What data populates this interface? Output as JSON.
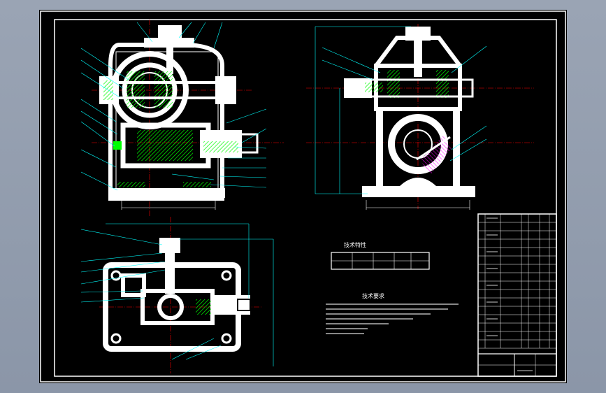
{
  "drawing": {
    "tech_spec_title": "技术特性",
    "tech_req_title": "技术要求",
    "colors": {
      "background": "#000000",
      "frame": "#ffffff",
      "part": "#ffffff",
      "leader": "#00ffff",
      "centerline": "#ff0000",
      "hatch": "#00ff00",
      "detail": "#ff00ff"
    }
  }
}
